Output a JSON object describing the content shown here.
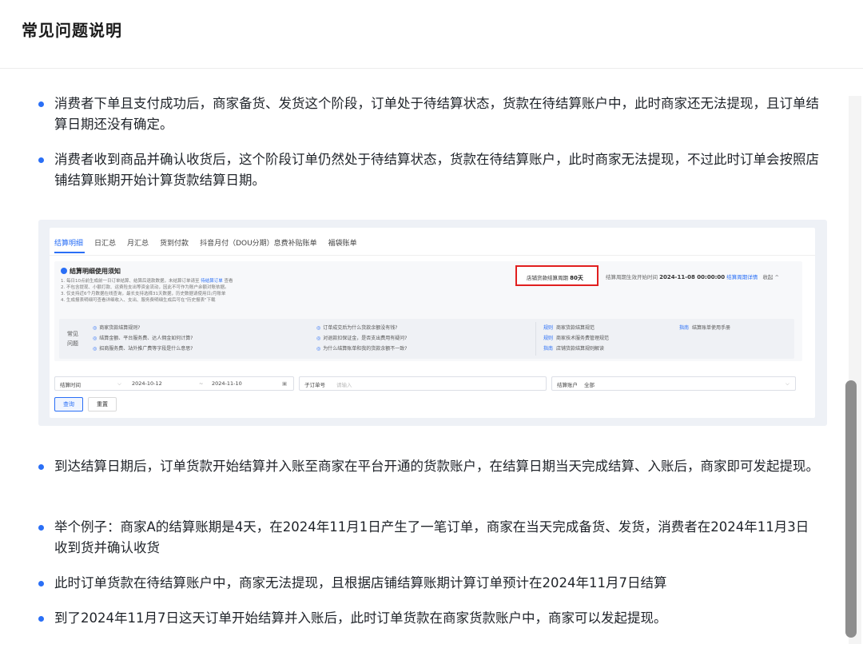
{
  "header": {
    "title": "常见问题说明"
  },
  "bullets_top": [
    "消费者下单且支付成功后，商家备货、发货这个阶段，订单处于待结算状态，货款在待结算账户中，此时商家还无法提现，且订单结算日期还没有确定。",
    "消费者收到商品并确认收货后，这个阶段订单仍然处于待结算状态，货款在待结算账户，此时商家无法提现，不过此时订单会按照店铺结算账期开始计算货款结算日期。"
  ],
  "bullets_bottom": [
    "到达结算日期后，订单货款开始结算并入账至商家在平台开通的货款账户，在结算日期当天完成结算、入账后，商家即可发起提现。",
    "举个例子：商家A的结算账期是4天，在2024年11月1日产生了一笔订单，商家在当天完成备货、发货，消费者在2024年11月3日收到货并确认收货",
    "此时订单货款在待结算账户中，商家无法提现，且根据店铺结算账期计算订单预计在2024年11月7日结算",
    "到了2024年11月7日这天订单开始结算并入账后，此时订单货款在商家货款账户中，商家可以发起提现。"
  ],
  "shot": {
    "tabs": [
      "结算明细",
      "日汇总",
      "月汇总",
      "货到付款",
      "抖音月付（DOU分期）息费补贴账单",
      "福袋账单"
    ],
    "notice_title": "结算明细使用须知",
    "notes": [
      "1. 每日10点前生成前一日订单结算、结算后退款数据，未结算订单请至",
      "待结算订单",
      "查看",
      "2. 不包含提现、小额打款、运费险支出等资金流动，因此不可作为账户余额对账依据。",
      "3. 仅支持近6个月数据在线查询，最长支持选择31天数据，历史数据请使用日/月账单",
      "4. 生成报表明细可查看详细收入、支出、服务费明细生成后可在\"历史报表\"下载"
    ],
    "period_label": "店铺货款结算周期",
    "period_value": "80天",
    "period_right_label": "结算周期生效开始时间",
    "period_right_value": "2024-11-08 00:00:00",
    "period_right_link": "结算周期详情",
    "period_right_collapse": "收起 ^",
    "faq_label": "常见问题",
    "faq_left": [
      "商家货款结算规则?",
      "结算金额、平台服务费、达人佣金如何计算?",
      "招商服务费、站外推广费等字段是什么意思?"
    ],
    "faq_mid": [
      "订单成交后为什么货款余额没有钱?",
      "对退款扣保证金，是否支出费用有疑问?",
      "为什么结算账单和我的货款余额不一致?"
    ],
    "faq_right": [
      {
        "tag": "规则",
        "text": "商家货款结算规范"
      },
      {
        "tag": "规则",
        "text": "商家技术服务费管理规范"
      },
      {
        "tag": "指南",
        "text": "店铺货款结算规则解读"
      }
    ],
    "faq_far": {
      "tag": "指南",
      "text": "结算账单使用手册"
    },
    "filter_time_label": "结算时间",
    "filter_start": "2024-10-12",
    "filter_end": "2024-11-10",
    "filter_order_label": "子订单号",
    "filter_order_placeholder": "请输入",
    "filter_account_label": "结算账户",
    "filter_account_value": "全部",
    "btn_query": "查询",
    "btn_reset": "重置"
  }
}
